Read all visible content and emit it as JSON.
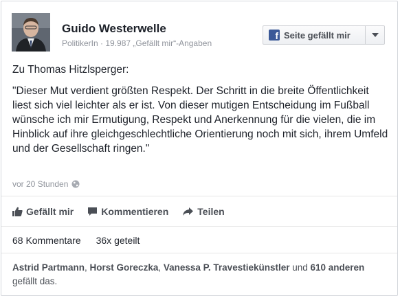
{
  "page": {
    "name": "Guido Westerwelle",
    "category": "PolitikerIn",
    "likes_text": "19.987 „Gefällt mir“-Angaben",
    "like_button_label": "Seite gefällt mir",
    "like_button_icon": "facebook-logo-icon"
  },
  "post": {
    "intro": "Zu Thomas Hitzlsperger:",
    "quote": "\"Dieser Mut verdient größten Respekt. Der Schritt in die breite Öffentlichkeit liest sich viel leichter als er ist. Von dieser mutigen Entscheidung im Fußball wünsche ich mir Ermutigung, Respekt und Anerkennung für die vielen, die im Hinblick auf ihre gleichgeschlechtliche Orientierung noch mit sich, ihrem Umfeld und der Gesellschaft ringen.\"",
    "timestamp": "vor 20 Stunden",
    "audience_icon": "globe-icon"
  },
  "actions": {
    "like": "Gefällt mir",
    "comment": "Kommentieren",
    "share": "Teilen"
  },
  "stats": {
    "comments": "68 Kommentare",
    "shares": "36x geteilt"
  },
  "likers": {
    "names": [
      "Astrid Partmann",
      "Horst Goreczka",
      "Vanessa P. Travestiekünstler"
    ],
    "sep": ", ",
    "and": " und ",
    "others": "610 anderen",
    "suffix": " gefällt das."
  },
  "colors": {
    "brand": "#3b5998",
    "text": "#1d2129",
    "muted": "#90949c",
    "action": "#4b4f56"
  }
}
